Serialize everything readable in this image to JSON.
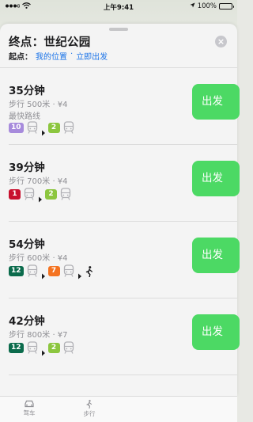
{
  "status_bar": {
    "time": "上午9:41",
    "battery": "100%",
    "battery_level": 1.0
  },
  "header": {
    "title": "终点：世纪公园",
    "origin_label": "起点：",
    "origin_value": "我的位置",
    "origin_separator": "·",
    "departure": "立即出发"
  },
  "colors": {
    "go_button": "#4cd964",
    "link": "#1a73e8",
    "line_10": "#a78bdc",
    "line_2": "#8cc63f",
    "line_1": "#c8102e",
    "line_12": "#0b6b4c",
    "line_7": "#f47321"
  },
  "routes": [
    {
      "duration": "35分钟",
      "meta": "步行 500米 · ¥4",
      "tag": "最快路线",
      "legs": [
        {
          "type": "line",
          "number": "10",
          "color": "#a78bdc"
        },
        {
          "type": "train-icon"
        },
        {
          "type": "arrow"
        },
        {
          "type": "line",
          "number": "2",
          "color": "#8cc63f"
        },
        {
          "type": "train-icon"
        }
      ],
      "button": "出发"
    },
    {
      "duration": "39分钟",
      "meta": "步行 700米 · ¥4",
      "tag": "",
      "legs": [
        {
          "type": "line",
          "number": "1",
          "color": "#c8102e"
        },
        {
          "type": "train-icon"
        },
        {
          "type": "arrow"
        },
        {
          "type": "line",
          "number": "2",
          "color": "#8cc63f"
        },
        {
          "type": "train-icon"
        }
      ],
      "button": "出发"
    },
    {
      "duration": "54分钟",
      "meta": "步行 600米 · ¥4",
      "tag": "",
      "legs": [
        {
          "type": "line",
          "number": "12",
          "color": "#0b6b4c"
        },
        {
          "type": "train-icon"
        },
        {
          "type": "arrow"
        },
        {
          "type": "line",
          "number": "7",
          "color": "#f47321"
        },
        {
          "type": "train-icon"
        },
        {
          "type": "arrow"
        },
        {
          "type": "walk-icon"
        }
      ],
      "button": "出发"
    },
    {
      "duration": "42分钟",
      "meta": "步行 800米 · ¥7",
      "tag": "",
      "legs": [
        {
          "type": "line",
          "number": "12",
          "color": "#0b6b4c"
        },
        {
          "type": "train-icon"
        },
        {
          "type": "arrow"
        },
        {
          "type": "line",
          "number": "2",
          "color": "#8cc63f"
        },
        {
          "type": "train-icon"
        }
      ],
      "button": "出发"
    }
  ],
  "tabs": [
    {
      "label": "驾车",
      "icon": "car-icon"
    },
    {
      "label": "步行",
      "icon": "walk-icon"
    }
  ]
}
